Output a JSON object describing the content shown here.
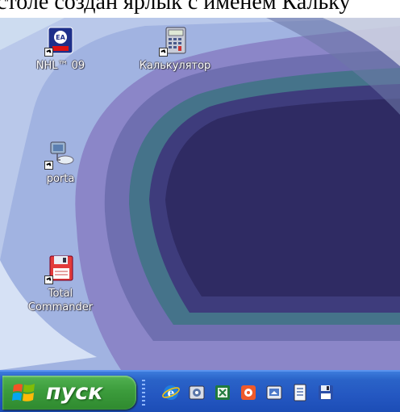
{
  "caption": {
    "text": "столе создан ярлык с именем Кальку"
  },
  "desktop": {
    "icons": [
      {
        "label": "NHL™ 09",
        "icon": "nhl09-icon"
      },
      {
        "label": "Калькулятор",
        "icon": "calculator-icon"
      },
      {
        "label": "porta",
        "icon": "network-computer-icon"
      },
      {
        "label": "Total",
        "label2": "Commander",
        "icon": "floppy-disk-icon"
      }
    ]
  },
  "taskbar": {
    "start_label": "пуск",
    "quick_launch": [
      "internet-explorer-icon",
      "settings-icon",
      "excel-icon",
      "media-icon",
      "desktop-show-icon",
      "notepad-icon",
      "floppy-disk-icon"
    ]
  },
  "colors": {
    "taskbar": "#2457c1",
    "start_button": "#3c9c3c",
    "wallpaper_light": "#c9d9ee",
    "wallpaper_dark": "#2f2b63"
  }
}
